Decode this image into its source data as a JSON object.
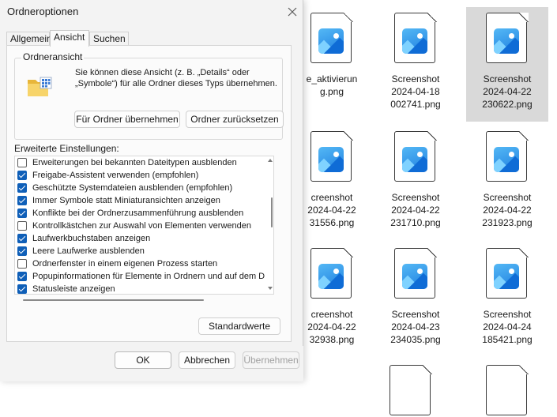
{
  "dialog": {
    "title": "Ordneroptionen",
    "close_icon": "close-icon",
    "tabs": [
      {
        "label": "Allgemein",
        "active": false
      },
      {
        "label": "Ansicht",
        "active": true
      },
      {
        "label": "Suchen",
        "active": false
      }
    ],
    "folder_view": {
      "group_label": "Ordneransicht",
      "description": "Sie können diese Ansicht (z. B. „Details“ oder „Symbole“) für alle Ordner dieses Typs übernehmen.",
      "apply_label": "Für Ordner übernehmen",
      "reset_label": "Ordner zurücksetzen",
      "icon": "folder-icon"
    },
    "advanced_label": "Erweiterte Einstellungen:",
    "settings": [
      {
        "label": "Erweiterungen bei bekannten Dateitypen ausblenden",
        "checked": false
      },
      {
        "label": "Freigabe-Assistent verwenden (empfohlen)",
        "checked": true
      },
      {
        "label": "Geschützte Systemdateien ausblenden (empfohlen)",
        "checked": true
      },
      {
        "label": "Immer Symbole statt Miniaturansichten anzeigen",
        "checked": true
      },
      {
        "label": "Konflikte bei der Ordnerzusammenführung ausblenden",
        "checked": true
      },
      {
        "label": "Kontrollkästchen zur Auswahl von Elementen verwenden",
        "checked": false
      },
      {
        "label": "Laufwerkbuchstaben anzeigen",
        "checked": true
      },
      {
        "label": "Leere Laufwerke ausblenden",
        "checked": true
      },
      {
        "label": "Ordnerfenster in einem eigenen Prozess starten",
        "checked": false
      },
      {
        "label": "Popupinformationen für Elemente in Ordnern und auf dem D",
        "checked": true
      },
      {
        "label": "Statusleiste anzeigen",
        "checked": true
      }
    ],
    "defaults_label": "Standardwerte",
    "ok_label": "OK",
    "cancel_label": "Abbrechen",
    "apply_label": "Übernehmen"
  },
  "explorer": {
    "files": [
      {
        "line1": "",
        "line2": "e_aktivierun",
        "line3": "g.png",
        "selected": false
      },
      {
        "line1": "Screenshot",
        "line2": "2024-04-18",
        "line3": "002741.png",
        "selected": false
      },
      {
        "line1": "Screenshot",
        "line2": "2024-04-22",
        "line3": "230622.png",
        "selected": true
      },
      {
        "line1": "creenshot",
        "line2": "2024-04-22",
        "line3": "31556.png",
        "selected": false
      },
      {
        "line1": "Screenshot",
        "line2": "2024-04-22",
        "line3": "231710.png",
        "selected": false
      },
      {
        "line1": "Screenshot",
        "line2": "2024-04-22",
        "line3": "231923.png",
        "selected": false
      },
      {
        "line1": "creenshot",
        "line2": "2024-04-22",
        "line3": "32938.png",
        "selected": false
      },
      {
        "line1": "Screenshot",
        "line2": "2024-04-23",
        "line3": "234035.png",
        "selected": false
      },
      {
        "line1": "Screenshot",
        "line2": "2024-04-24",
        "line3": "185421.png",
        "selected": false
      }
    ],
    "file_icon": "image-file-icon"
  },
  "colors": {
    "accent": "#0f5fb8",
    "selection": "#d9d9d9",
    "dialog_bg": "#f3f3f3"
  }
}
